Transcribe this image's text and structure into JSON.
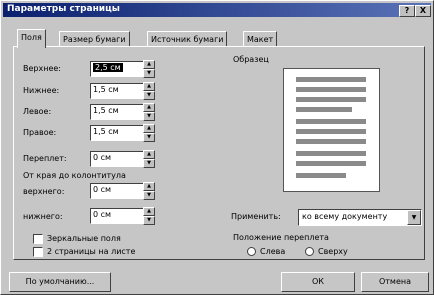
{
  "window": {
    "title": "Параметры страницы",
    "help_btn": "?",
    "close_btn": "X"
  },
  "tabs": [
    "Поля",
    "Размер бумаги",
    "Источник бумаги",
    "Макет"
  ],
  "fields": {
    "top": {
      "label": "Верхнее:",
      "value": "2,5 см"
    },
    "bottom": {
      "label": "Нижнее:",
      "value": "1,5 см"
    },
    "left": {
      "label": "Левое:",
      "value": "1,5 см"
    },
    "right": {
      "label": "Правое:",
      "value": "1,5 см"
    },
    "gutter": {
      "label": "Переплет:",
      "value": "0 см"
    },
    "from_edge": "От края до колонтитула",
    "header": {
      "label": "верхнего:",
      "value": "0 см"
    },
    "footer": {
      "label": "нижнего:",
      "value": "0 см"
    }
  },
  "checkboxes": {
    "mirror": "Зеркальные поля",
    "two_pages": "2 страницы на листе"
  },
  "sample": {
    "label": "Образец"
  },
  "apply": {
    "label": "Применить:",
    "value": "ко всему документу"
  },
  "gutter_pos": {
    "label": "Положение переплета",
    "left": "Слева",
    "top": "Сверху"
  },
  "buttons": {
    "default": "По умолчанию...",
    "ok": "ОК",
    "cancel": "Отмена"
  }
}
